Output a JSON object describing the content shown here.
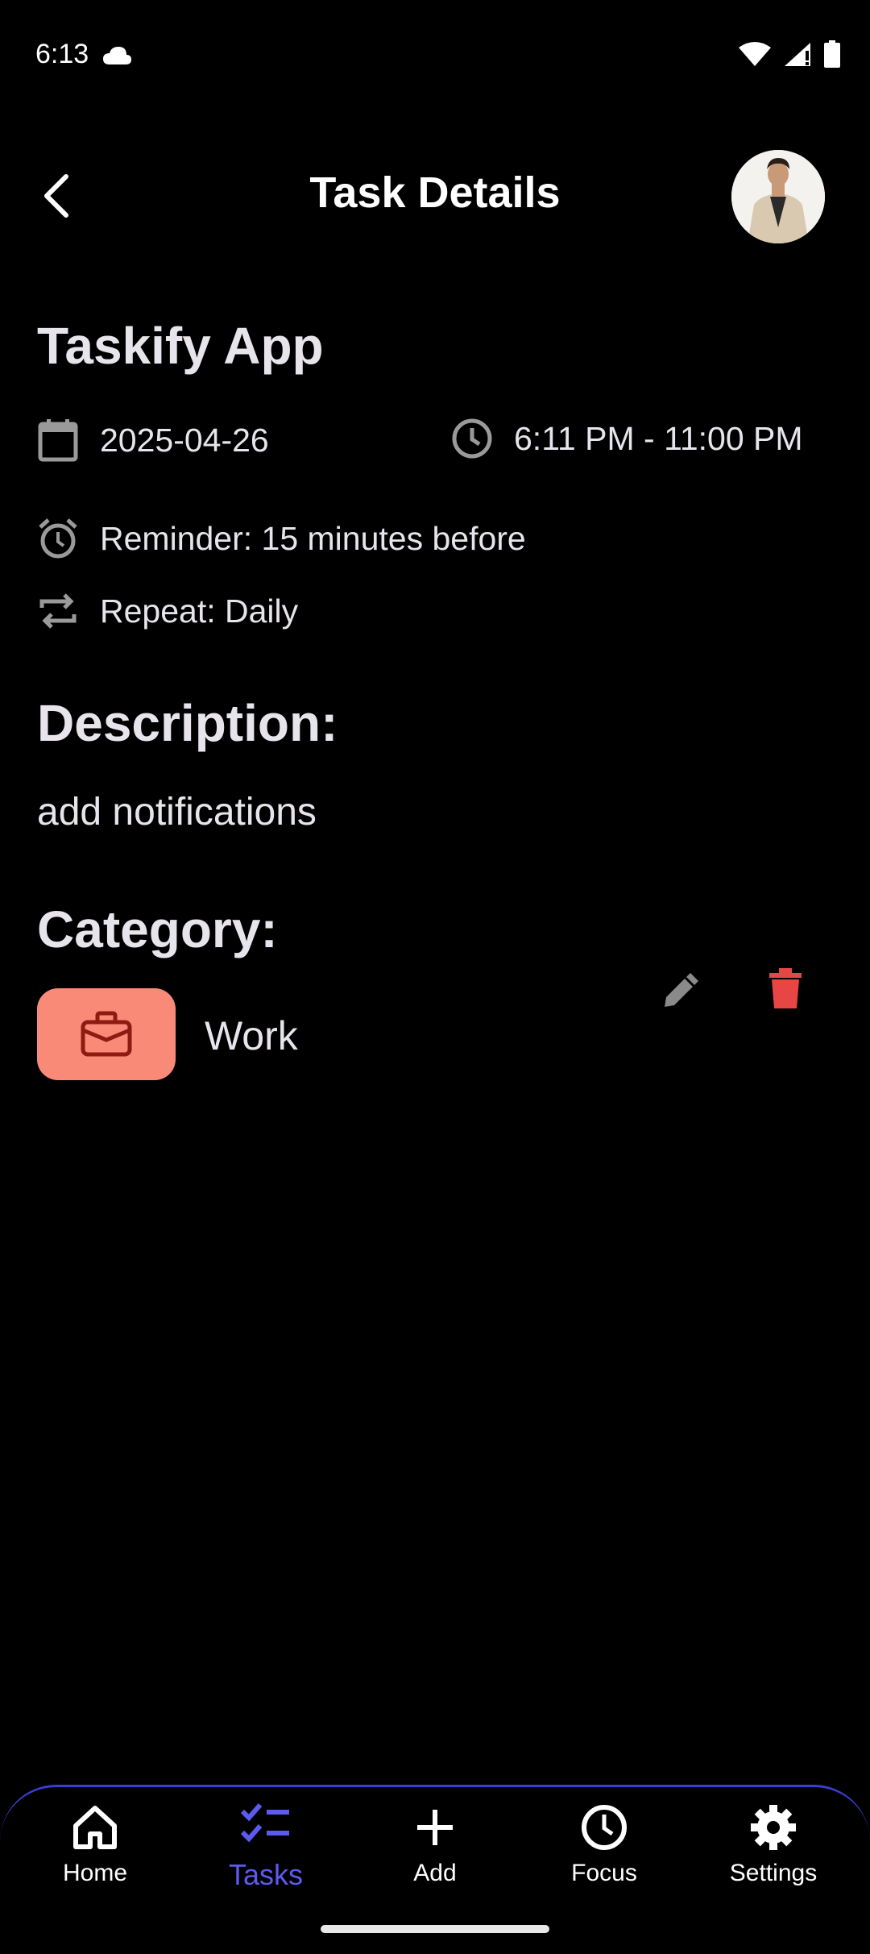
{
  "status_bar": {
    "time": "6:13"
  },
  "header": {
    "title": "Task Details"
  },
  "task": {
    "title": "Taskify App",
    "date": "2025-04-26",
    "time_range": "6:11 PM - 11:00 PM",
    "reminder": "Reminder: 15 minutes before",
    "repeat": "Repeat: Daily"
  },
  "description": {
    "heading": "Description:",
    "text": "add notifications"
  },
  "category": {
    "heading": "Category:",
    "name": "Work",
    "color": "#fa8a78"
  },
  "colors": {
    "accent": "#5b5bf2",
    "delete": "#e84545",
    "edit": "#8a8a8a"
  },
  "bottom_nav": {
    "items": [
      {
        "label": "Home",
        "icon": "home-icon"
      },
      {
        "label": "Tasks",
        "icon": "tasks-icon",
        "active": true
      },
      {
        "label": "Add",
        "icon": "plus-icon"
      },
      {
        "label": "Focus",
        "icon": "clock-icon"
      },
      {
        "label": "Settings",
        "icon": "gear-icon"
      }
    ]
  }
}
